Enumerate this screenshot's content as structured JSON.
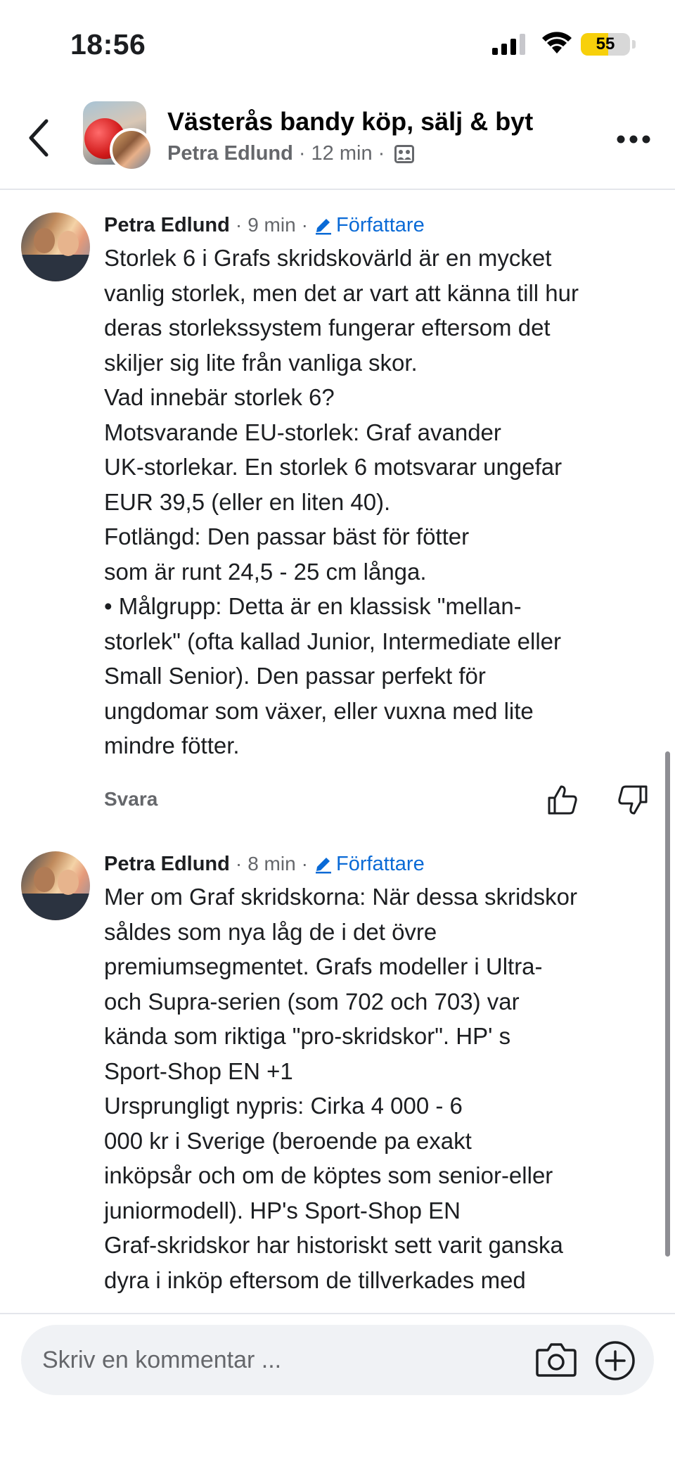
{
  "status_bar": {
    "time": "18:56",
    "battery_level": "55",
    "battery_fraction": 0.55
  },
  "header": {
    "group_name": "Västerås bandy köp, sälj & byt",
    "post_author": "Petra Edlund",
    "post_time": "12 min",
    "separator": "·"
  },
  "comments": [
    {
      "author": "Petra Edlund",
      "time": "9 min",
      "separator": "·",
      "badge": "Författare",
      "text": "Storlek 6 i Grafs skridskovärld är en mycket\nvanlig storlek, men det ar vart att känna till hur\nderas storlekssystem fungerar eftersom det\nskiljer sig lite från vanliga skor.\nVad innebär storlek 6?\nMotsvarande EU-storlek: Graf avander\nUK-storlekar. En storlek 6 motsvarar ungefar\nEUR 39,5 (eller en liten 40).\nFotlängd: Den passar bäst för fötter\nsom är runt 24,5 - 25 cm långa.\n• Målgrupp: Detta är en klassisk \"mellan-\nstorlek\" (ofta kallad Junior, Intermediate eller\nSmall Senior). Den passar perfekt för\nungdomar som växer, eller vuxna med lite\nmindre fötter.",
      "reply_label": "Svara"
    },
    {
      "author": "Petra Edlund",
      "time": "8 min",
      "separator": "·",
      "badge": "Författare",
      "text": "Mer om Graf skridskorna: När dessa skridskor\nsåldes som nya låg de i det övre\npremiumsegmentet. Grafs modeller i Ultra-\noch Supra-serien (som 702 och 703) var\nkända som riktiga \"pro-skridskor\". HP' s\nSport-Shop EN +1\nUrsprungligt nypris: Cirka 4 000 - 6\n000 kr i Sverige (beroende pa exakt\ninköpsår och om de köptes som senior-eller\njuniormodell). HP's Sport-Shop EN\nGraf-skridskor har historiskt sett varit ganska\ndyra i inköp eftersom de tillverkades med\nmycket hög kvalitet"
    }
  ],
  "composer": {
    "placeholder": "Skriv en kommentar ..."
  },
  "icons": {
    "back": "chevron-left-icon",
    "more": "more-horizontal-icon",
    "privacy": "group-members-icon",
    "author_badge": "pen-icon",
    "like": "thumbs-up-icon",
    "dislike": "thumbs-down-icon",
    "camera": "camera-icon",
    "add": "plus-circle-icon"
  },
  "colors": {
    "accent_blue": "#0a6ad6",
    "meta_gray": "#65676b",
    "text": "#1c1e21",
    "composer_bg": "#f0f2f5",
    "battery_yellow": "#f7d00b"
  }
}
